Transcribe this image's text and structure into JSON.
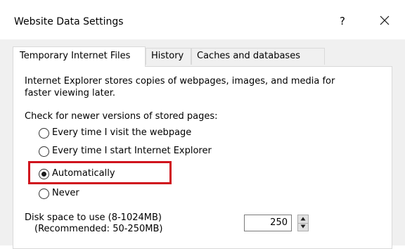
{
  "window": {
    "title": "Website Data Settings",
    "help_label": "?"
  },
  "tabs": [
    {
      "label": "Temporary Internet Files",
      "active": true
    },
    {
      "label": "History",
      "active": false
    },
    {
      "label": "Caches and databases",
      "active": false
    }
  ],
  "panel": {
    "description": "Internet Explorer stores copies of webpages, images, and media for faster viewing later.",
    "check_label": "Check for newer versions of stored pages:",
    "options": [
      {
        "label": "Every time I visit the webpage",
        "selected": false
      },
      {
        "label": "Every time I start Internet Explorer",
        "selected": false
      },
      {
        "label": "Automatically",
        "selected": true
      },
      {
        "label": "Never",
        "selected": false
      }
    ],
    "disk_label": "Disk space to use (8-1024MB)",
    "disk_recommended": "(Recommended: 50-250MB)",
    "disk_value": "250"
  },
  "colors": {
    "highlight": "#d0131d",
    "panel_bg": "#ffffff",
    "window_bg": "#f0f0f0"
  },
  "icons": {
    "close": "close-icon",
    "spin_up": "arrow-up-icon",
    "spin_down": "arrow-down-icon"
  }
}
